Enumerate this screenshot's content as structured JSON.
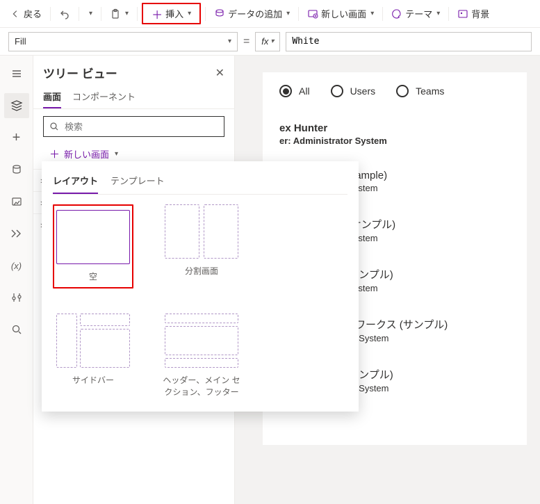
{
  "toolbar": {
    "back": "戻る",
    "insert": "挿入",
    "addData": "データの追加",
    "newScreen": "新しい画面",
    "theme": "テーマ",
    "background": "背景"
  },
  "formula": {
    "property": "Fill",
    "fx": "fx",
    "value": "White"
  },
  "tree": {
    "title": "ツリー ビュー",
    "tabScreens": "画面",
    "tabComponents": "コンポーネント",
    "searchPlaceholder": "検索",
    "newScreen": "新しい画面"
  },
  "popover": {
    "tabLayout": "レイアウト",
    "tabTemplate": "テンプレート",
    "items": [
      {
        "label": "空"
      },
      {
        "label": "分割画面"
      },
      {
        "label": "サイドバー"
      },
      {
        "label": "ヘッダー、メイン セクション、フッター"
      }
    ]
  },
  "canvas": {
    "radios": [
      {
        "label": "All",
        "selected": true
      },
      {
        "label": "Users",
        "selected": false
      },
      {
        "label": "Teams",
        "selected": false
      }
    ],
    "records": [
      {
        "title": "ex Hunter",
        "sub": "er: Administrator System",
        "bold": true
      },
      {
        "title": "ine Ski House (sample)",
        "sub": "er: Administrator System",
        "bold": false
      },
      {
        "title": "ース コーヒー (サンプル)",
        "sub": "er: Administrator System",
        "bold": false
      },
      {
        "title": "ビングウェア (サンプル)",
        "sub": "er: Administrator System",
        "bold": false
      },
      {
        "title": "アドベンチャー ワークス (サンプル)",
        "sub": "User: Administrator System",
        "bold": false
      },
      {
        "title": "ファブリカム (サンプル)",
        "sub": "User: Administrator System",
        "bold": false
      }
    ]
  }
}
